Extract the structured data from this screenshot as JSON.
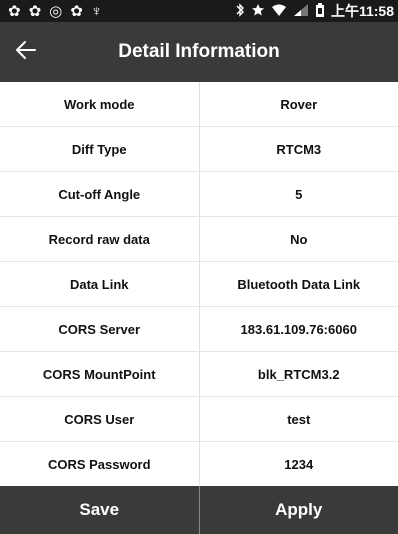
{
  "status_bar": {
    "left_icons": [
      "✿",
      "✿",
      "◎",
      "✿",
      "♆"
    ],
    "right_icons": [
      "bluetooth-icon",
      "star-icon",
      "wifi-icon",
      "signal-icon",
      "battery-icon"
    ],
    "time": "上午11:58"
  },
  "header": {
    "title": "Detail Information",
    "back_icon": "arrow-left-icon"
  },
  "details": [
    {
      "label": "Work mode",
      "value": "Rover"
    },
    {
      "label": "Diff Type",
      "value": "RTCM3"
    },
    {
      "label": "Cut-off Angle",
      "value": "5"
    },
    {
      "label": "Record raw data",
      "value": "No"
    },
    {
      "label": "Data Link",
      "value": "Bluetooth Data Link"
    },
    {
      "label": "CORS Server",
      "value": "183.61.109.76:6060"
    },
    {
      "label": "CORS MountPoint",
      "value": "blk_RTCM3.2"
    },
    {
      "label": "CORS User",
      "value": "test"
    },
    {
      "label": "CORS Password",
      "value": "1234"
    }
  ],
  "footer": {
    "save_label": "Save",
    "apply_label": "Apply"
  },
  "colors": {
    "status_bar": "#1a1a1a",
    "app_bar": "#3a3a3a",
    "footer": "#3a3a3a",
    "text_light": "#ffffff",
    "text_dark": "#111111"
  }
}
